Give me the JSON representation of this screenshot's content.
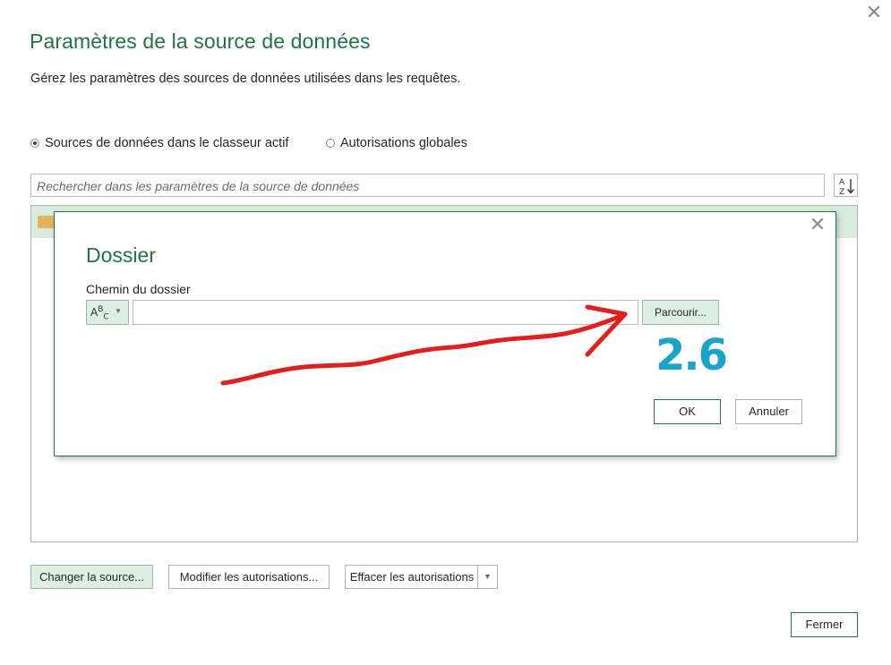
{
  "window": {
    "title": "Paramètres de la source de données",
    "subtitle": "Gérez les paramètres des sources de données utilisées dans les requêtes.",
    "close_icon": "✕"
  },
  "scope": {
    "option1": "Sources de données dans le classeur actif",
    "option2": "Autorisations globales",
    "selected": "option1"
  },
  "search": {
    "placeholder": "Rechercher dans les paramètres de la source de données"
  },
  "sort_icon": "sort-az-icon",
  "list": {
    "rows": [
      {
        "icon": "folder-icon"
      }
    ]
  },
  "buttons": {
    "change": "Changer la source...",
    "modify": "Modifier les autorisations...",
    "clear": "Effacer les autorisations",
    "close": "Fermer"
  },
  "dialog": {
    "title": "Dossier",
    "path_label": "Chemin du dossier",
    "type_label": "ABC",
    "path_value": "",
    "browse": "Parcourir...",
    "ok": "OK",
    "cancel": "Annuler",
    "close_icon": "✕"
  },
  "annotation": {
    "text": "2.6",
    "arrow_color": "#e0201e",
    "text_color": "#1ba3c9",
    "highlight_color": "#f4f33a"
  },
  "colors": {
    "accent": "#217346",
    "selected_bg": "#d8ecdd"
  }
}
